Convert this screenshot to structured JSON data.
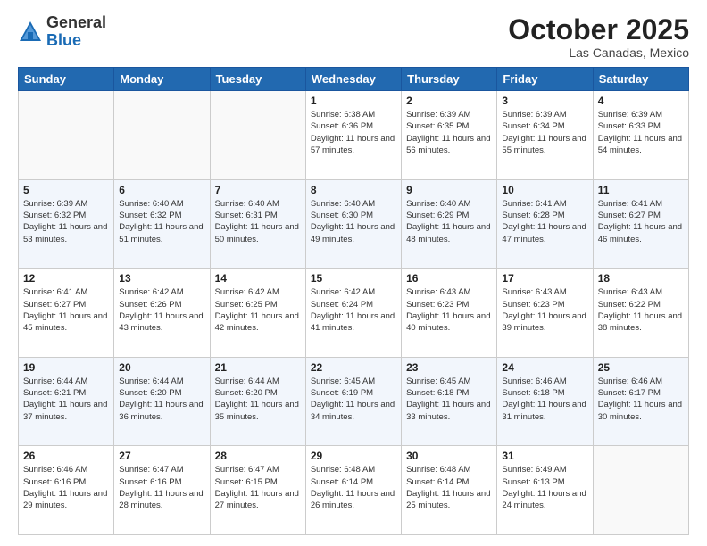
{
  "header": {
    "logo_general": "General",
    "logo_blue": "Blue",
    "month": "October 2025",
    "location": "Las Canadas, Mexico"
  },
  "days_of_week": [
    "Sunday",
    "Monday",
    "Tuesday",
    "Wednesday",
    "Thursday",
    "Friday",
    "Saturday"
  ],
  "weeks": [
    [
      {
        "day": "",
        "info": ""
      },
      {
        "day": "",
        "info": ""
      },
      {
        "day": "",
        "info": ""
      },
      {
        "day": "1",
        "info": "Sunrise: 6:38 AM\nSunset: 6:36 PM\nDaylight: 11 hours and 57 minutes."
      },
      {
        "day": "2",
        "info": "Sunrise: 6:39 AM\nSunset: 6:35 PM\nDaylight: 11 hours and 56 minutes."
      },
      {
        "day": "3",
        "info": "Sunrise: 6:39 AM\nSunset: 6:34 PM\nDaylight: 11 hours and 55 minutes."
      },
      {
        "day": "4",
        "info": "Sunrise: 6:39 AM\nSunset: 6:33 PM\nDaylight: 11 hours and 54 minutes."
      }
    ],
    [
      {
        "day": "5",
        "info": "Sunrise: 6:39 AM\nSunset: 6:32 PM\nDaylight: 11 hours and 53 minutes."
      },
      {
        "day": "6",
        "info": "Sunrise: 6:40 AM\nSunset: 6:32 PM\nDaylight: 11 hours and 51 minutes."
      },
      {
        "day": "7",
        "info": "Sunrise: 6:40 AM\nSunset: 6:31 PM\nDaylight: 11 hours and 50 minutes."
      },
      {
        "day": "8",
        "info": "Sunrise: 6:40 AM\nSunset: 6:30 PM\nDaylight: 11 hours and 49 minutes."
      },
      {
        "day": "9",
        "info": "Sunrise: 6:40 AM\nSunset: 6:29 PM\nDaylight: 11 hours and 48 minutes."
      },
      {
        "day": "10",
        "info": "Sunrise: 6:41 AM\nSunset: 6:28 PM\nDaylight: 11 hours and 47 minutes."
      },
      {
        "day": "11",
        "info": "Sunrise: 6:41 AM\nSunset: 6:27 PM\nDaylight: 11 hours and 46 minutes."
      }
    ],
    [
      {
        "day": "12",
        "info": "Sunrise: 6:41 AM\nSunset: 6:27 PM\nDaylight: 11 hours and 45 minutes."
      },
      {
        "day": "13",
        "info": "Sunrise: 6:42 AM\nSunset: 6:26 PM\nDaylight: 11 hours and 43 minutes."
      },
      {
        "day": "14",
        "info": "Sunrise: 6:42 AM\nSunset: 6:25 PM\nDaylight: 11 hours and 42 minutes."
      },
      {
        "day": "15",
        "info": "Sunrise: 6:42 AM\nSunset: 6:24 PM\nDaylight: 11 hours and 41 minutes."
      },
      {
        "day": "16",
        "info": "Sunrise: 6:43 AM\nSunset: 6:23 PM\nDaylight: 11 hours and 40 minutes."
      },
      {
        "day": "17",
        "info": "Sunrise: 6:43 AM\nSunset: 6:23 PM\nDaylight: 11 hours and 39 minutes."
      },
      {
        "day": "18",
        "info": "Sunrise: 6:43 AM\nSunset: 6:22 PM\nDaylight: 11 hours and 38 minutes."
      }
    ],
    [
      {
        "day": "19",
        "info": "Sunrise: 6:44 AM\nSunset: 6:21 PM\nDaylight: 11 hours and 37 minutes."
      },
      {
        "day": "20",
        "info": "Sunrise: 6:44 AM\nSunset: 6:20 PM\nDaylight: 11 hours and 36 minutes."
      },
      {
        "day": "21",
        "info": "Sunrise: 6:44 AM\nSunset: 6:20 PM\nDaylight: 11 hours and 35 minutes."
      },
      {
        "day": "22",
        "info": "Sunrise: 6:45 AM\nSunset: 6:19 PM\nDaylight: 11 hours and 34 minutes."
      },
      {
        "day": "23",
        "info": "Sunrise: 6:45 AM\nSunset: 6:18 PM\nDaylight: 11 hours and 33 minutes."
      },
      {
        "day": "24",
        "info": "Sunrise: 6:46 AM\nSunset: 6:18 PM\nDaylight: 11 hours and 31 minutes."
      },
      {
        "day": "25",
        "info": "Sunrise: 6:46 AM\nSunset: 6:17 PM\nDaylight: 11 hours and 30 minutes."
      }
    ],
    [
      {
        "day": "26",
        "info": "Sunrise: 6:46 AM\nSunset: 6:16 PM\nDaylight: 11 hours and 29 minutes."
      },
      {
        "day": "27",
        "info": "Sunrise: 6:47 AM\nSunset: 6:16 PM\nDaylight: 11 hours and 28 minutes."
      },
      {
        "day": "28",
        "info": "Sunrise: 6:47 AM\nSunset: 6:15 PM\nDaylight: 11 hours and 27 minutes."
      },
      {
        "day": "29",
        "info": "Sunrise: 6:48 AM\nSunset: 6:14 PM\nDaylight: 11 hours and 26 minutes."
      },
      {
        "day": "30",
        "info": "Sunrise: 6:48 AM\nSunset: 6:14 PM\nDaylight: 11 hours and 25 minutes."
      },
      {
        "day": "31",
        "info": "Sunrise: 6:49 AM\nSunset: 6:13 PM\nDaylight: 11 hours and 24 minutes."
      },
      {
        "day": "",
        "info": ""
      }
    ]
  ]
}
